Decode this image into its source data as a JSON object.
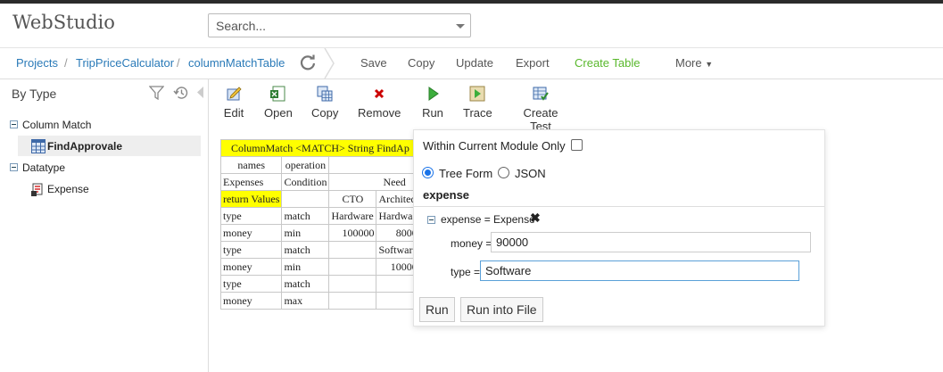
{
  "app": {
    "title": "WebStudio"
  },
  "search": {
    "placeholder": "Search..."
  },
  "breadcrumb": {
    "items": [
      "Projects",
      "TripPriceCalculator",
      "columnMatchTable"
    ],
    "separator": "/"
  },
  "toolbar_top": {
    "save": "Save",
    "copy": "Copy",
    "update": "Update",
    "export": "Export",
    "create_table": "Create Table",
    "more": "More"
  },
  "sidebar": {
    "title": "By Type",
    "tree": [
      {
        "label": "Column Match",
        "children": [
          "FindApprovale"
        ]
      },
      {
        "label": "Datatype",
        "children": [
          "Expense"
        ]
      }
    ]
  },
  "table_toolbar": {
    "edit": "Edit",
    "open": "Open",
    "copy": "Copy",
    "remove": "Remove",
    "run": "Run",
    "trace": "Trace",
    "create_test": "Create Test"
  },
  "grid": {
    "header": "ColumnMatch <MATCH> String FindAp",
    "row1": [
      "names",
      "operation",
      ""
    ],
    "row2": [
      "Expenses",
      "Condition",
      "Need"
    ],
    "row3": [
      "return Values",
      "",
      "CTO",
      "Architec"
    ],
    "rows": [
      [
        "type",
        "match",
        "Hardware",
        "Hardwa"
      ],
      [
        "money",
        "min",
        "100000",
        "8000"
      ],
      [
        "type",
        "match",
        "",
        "Software"
      ],
      [
        "money",
        "min",
        "",
        "10000"
      ],
      [
        "type",
        "match",
        "",
        ""
      ],
      [
        "money",
        "max",
        "",
        ""
      ]
    ]
  },
  "run_panel": {
    "within_module_label": "Within Current Module Only",
    "tree_form_label": "Tree Form",
    "json_label": "JSON",
    "section_title": "expense",
    "expense_node": "expense = Expense",
    "money_label": "money =",
    "money_value": "90000",
    "type_label": "type =",
    "type_value": "Software",
    "run_button": "Run",
    "run_into_file_button": "Run into File"
  },
  "colors": {
    "link": "#2a7ab8",
    "create_table": "#59b82c",
    "header_yellow": "#ffff00"
  }
}
